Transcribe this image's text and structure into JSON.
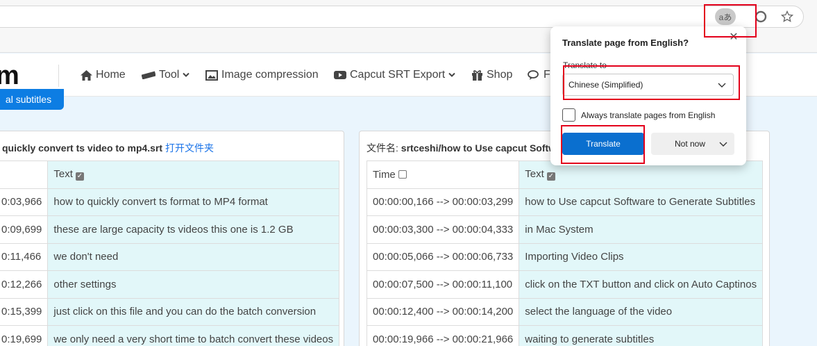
{
  "browser": {
    "translate_chip": "aあ"
  },
  "nav": {
    "logo": "m",
    "items": [
      "Home",
      "Tool",
      "Image compression",
      "Capcut SRT Export",
      "Shop",
      "F"
    ]
  },
  "page_button": "al subtitles",
  "left_panel": {
    "filename": "quickly convert ts video to mp4.srt",
    "open_folder_link": "打开文件夹",
    "header_text": "Text",
    "rows": [
      {
        "time": "0:03,966",
        "text": "how to quickly convert ts format to MP4 format"
      },
      {
        "time": "0:09,699",
        "text": "these are large capacity ts videos this one is 1.2 GB"
      },
      {
        "time": "0:11,466",
        "text": "we don't need"
      },
      {
        "time": "0:12,266",
        "text": "other settings"
      },
      {
        "time": "0:15,399",
        "text": "just click on this file and you can do the batch conversion"
      },
      {
        "time": "0:19,699",
        "text": "we only need a very short time to batch convert these videos"
      }
    ]
  },
  "right_panel": {
    "filename_label": "文件名:",
    "filename": "srtceshi/how to Use capcut Softw",
    "header_time": "Time",
    "header_text": "Text",
    "rows": [
      {
        "time": "00:00:00,166 --> 00:00:03,299",
        "text": "how to Use capcut Software to Generate Subtitles"
      },
      {
        "time": "00:00:03,300 --> 00:00:04,333",
        "text": "in Mac System"
      },
      {
        "time": "00:00:05,066 --> 00:00:06,733",
        "text": "Importing Video Clips"
      },
      {
        "time": "00:00:07,500 --> 00:00:11,100",
        "text": "click on the TXT button and click on Auto Captinos"
      },
      {
        "time": "00:00:12,400 --> 00:00:14,200",
        "text": "select the language of the video"
      },
      {
        "time": "00:00:19,966 --> 00:00:21,966",
        "text": "waiting to generate subtitles"
      }
    ]
  },
  "translate_popup": {
    "title": "Translate page from English?",
    "translate_to_label": "Translate to",
    "selected_language": "Chinese (Simplified)",
    "always_label": "Always translate pages from English",
    "translate_button": "Translate",
    "not_now_button": "Not now"
  },
  "colors": {
    "highlight": "#e3001b",
    "accent": "#0a6fcf",
    "text_column_bg": "#e2f7f9"
  }
}
